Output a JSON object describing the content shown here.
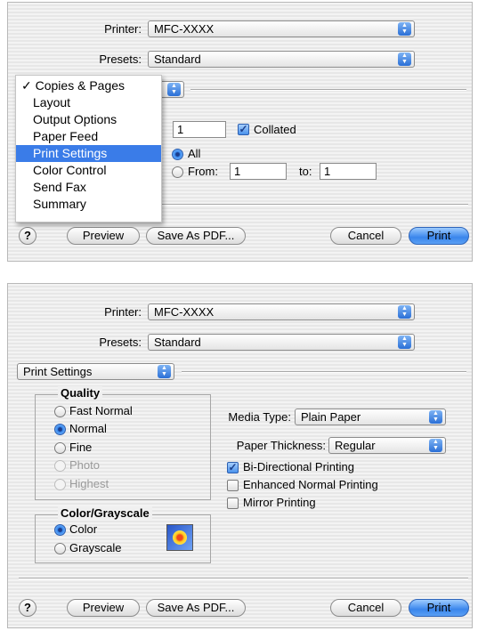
{
  "dialog1": {
    "printer_label": "Printer:",
    "printer_value": "MFC-XXXX",
    "presets_label": "Presets:",
    "presets_value": "Standard",
    "menu": {
      "items": [
        {
          "label": "✓ Copies & Pages"
        },
        {
          "label": "Layout"
        },
        {
          "label": "Output Options"
        },
        {
          "label": "Paper Feed"
        },
        {
          "label": "Print Settings"
        },
        {
          "label": "Color Control"
        },
        {
          "label": "Send Fax"
        },
        {
          "label": "Summary"
        }
      ],
      "selected": "Print Settings"
    },
    "copies_value": "1",
    "collated_label": "Collated",
    "pages_all_label": "All",
    "pages_from_label": "From:",
    "from_value": "1",
    "to_label": "to:",
    "to_value": "1",
    "help_label": "?",
    "preview_label": "Preview",
    "save_pdf_label": "Save As PDF...",
    "cancel_label": "Cancel",
    "print_label": "Print"
  },
  "dialog2": {
    "printer_label": "Printer:",
    "printer_value": "MFC-XXXX",
    "presets_label": "Presets:",
    "presets_value": "Standard",
    "panel_value": "Print Settings",
    "quality": {
      "title": "Quality",
      "options": [
        {
          "label": "Fast Normal",
          "selected": false,
          "enabled": true
        },
        {
          "label": "Normal",
          "selected": true,
          "enabled": true
        },
        {
          "label": "Fine",
          "selected": false,
          "enabled": true
        },
        {
          "label": "Photo",
          "selected": false,
          "enabled": false
        },
        {
          "label": "Highest",
          "selected": false,
          "enabled": false
        }
      ]
    },
    "color": {
      "title": "Color/Grayscale",
      "options": [
        {
          "label": "Color",
          "selected": true
        },
        {
          "label": "Grayscale",
          "selected": false
        }
      ]
    },
    "media_type_label": "Media Type:",
    "media_type_value": "Plain Paper",
    "paper_thickness_label": "Paper Thickness:",
    "paper_thickness_value": "Regular",
    "checks": [
      {
        "label": "Bi-Directional Printing",
        "checked": true
      },
      {
        "label": "Enhanced Normal Printing",
        "checked": false
      },
      {
        "label": "Mirror Printing",
        "checked": false
      }
    ],
    "help_label": "?",
    "preview_label": "Preview",
    "save_pdf_label": "Save As PDF...",
    "cancel_label": "Cancel",
    "print_label": "Print"
  },
  "colors": {
    "accent": "#3a7ce8",
    "default_button": "#3a86ec"
  }
}
